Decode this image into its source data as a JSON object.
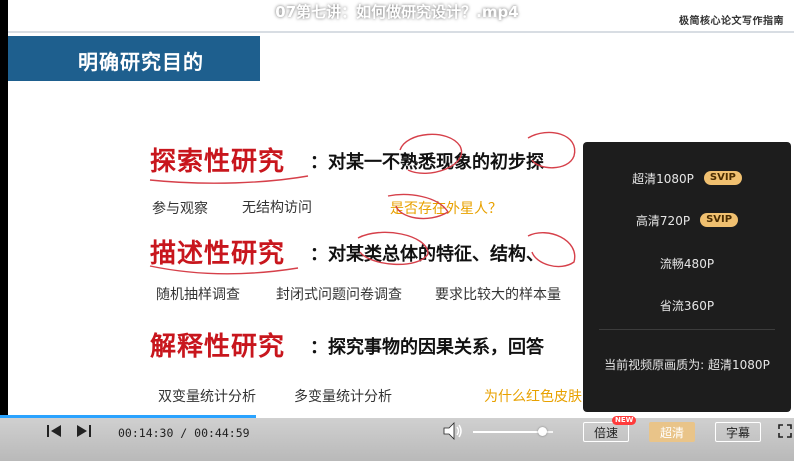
{
  "player": {
    "title": "07第七讲：如何做研究设计？.mp4",
    "brand": "极简核心论文写作指南"
  },
  "slide": {
    "header": "明确研究目的",
    "rows": [
      {
        "type": "探索性研究",
        "desc": "：对某一不熟悉现象的初步探",
        "subs": [
          "参与观察",
          "无结构访问"
        ],
        "extra": "是否存在外星人？"
      },
      {
        "type": "描述性研究",
        "desc": "：对某类总体的特征、结构、",
        "subs": [
          "随机抽样调查",
          "封闭式问题问卷调查",
          "要求比较大的样本量"
        ]
      },
      {
        "type": "解释性研究",
        "desc": "：探究事物的因果关系，回答",
        "subs": [
          "双变量统计分析",
          "多变量统计分析"
        ],
        "extra": "为什么红色皮肤"
      }
    ]
  },
  "quality_menu": {
    "items": [
      {
        "label": "超清1080P",
        "badge": "SVIP",
        "active": true
      },
      {
        "label": "高清720P",
        "badge": "SVIP",
        "active": false
      },
      {
        "label": "流畅480P",
        "badge": "",
        "active": false
      },
      {
        "label": "省流360P",
        "badge": "",
        "active": false
      }
    ],
    "original": "当前视频原画质为: 超清1080P"
  },
  "controls": {
    "current_time": "00:14:30",
    "duration": "00:44:59",
    "time_display": "00:14:30 / 00:44:59",
    "progress_fraction": 0.322,
    "volume_fraction": 0.82,
    "speed_label": "倍速",
    "new_badge": "NEW",
    "quality_label": "超清",
    "subtitle_label": "字幕"
  },
  "colors": {
    "accent": "#2aa3ff",
    "brand_red": "#c8161d",
    "header_blue": "#1e5f8e",
    "svip_gold": "#f0c070"
  },
  "icons": [
    "prev-icon",
    "next-icon",
    "volume-icon",
    "fullscreen-icon",
    "minimize-icon"
  ]
}
